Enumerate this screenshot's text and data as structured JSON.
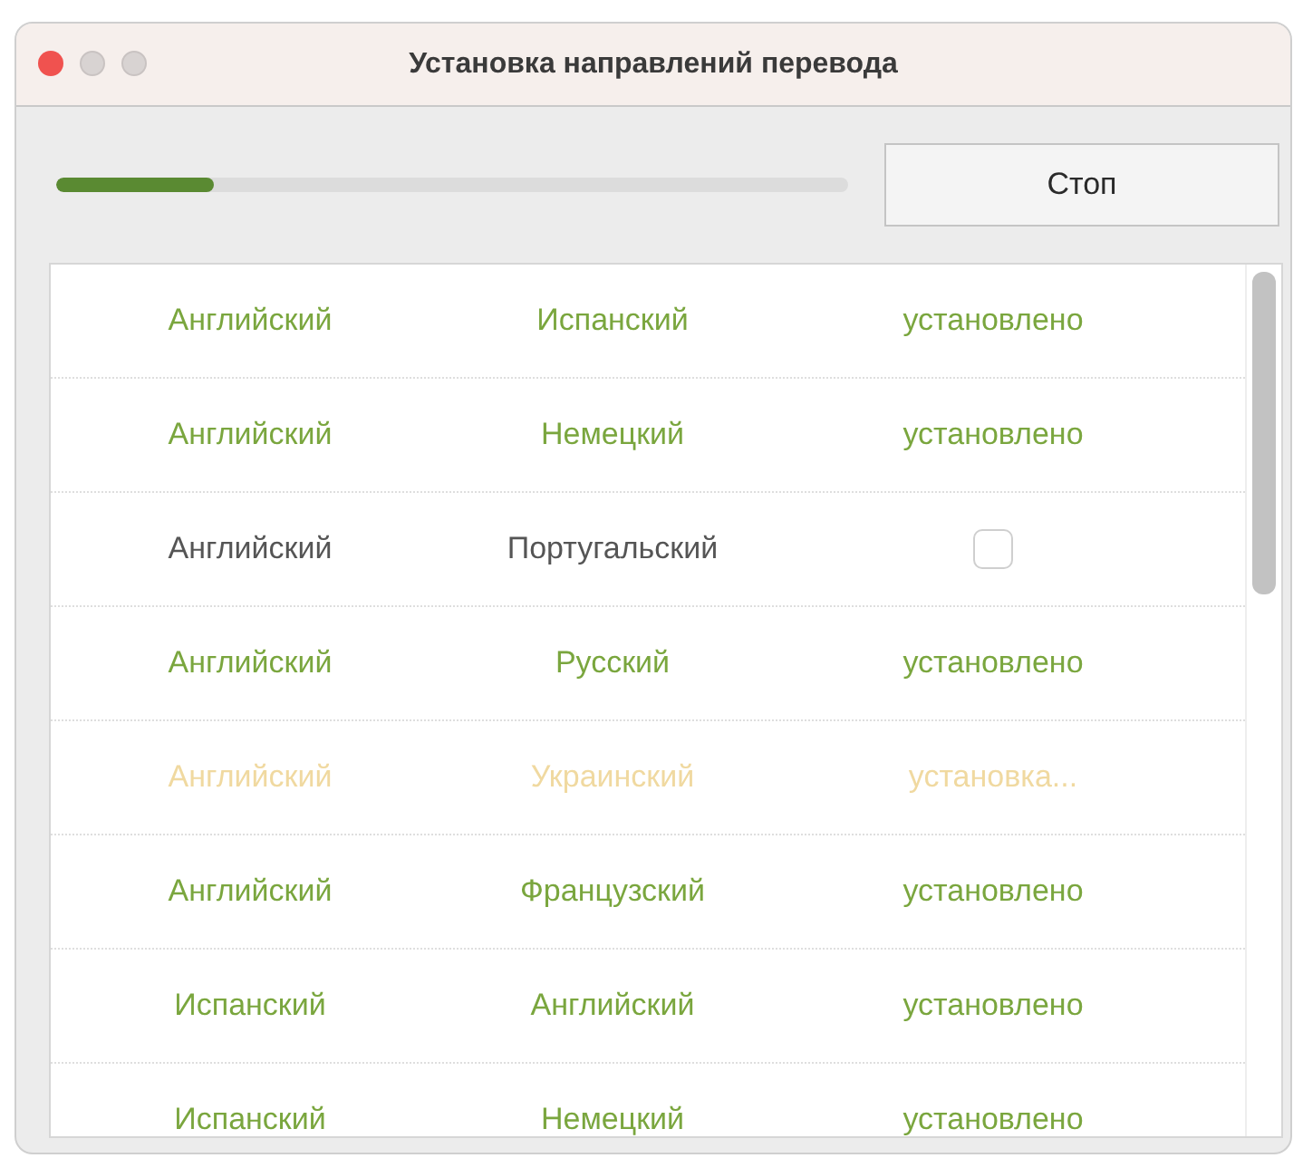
{
  "window": {
    "title": "Установка направлений перевода"
  },
  "progress": {
    "level": 0.2
  },
  "stop_button": {
    "label": "Стоп"
  },
  "rows": [
    {
      "kind": "installed",
      "source": "Английский",
      "target": "Испанский",
      "status": "установлено"
    },
    {
      "kind": "installed",
      "source": "Английский",
      "target": "Немецкий",
      "status": "установлено"
    },
    {
      "kind": "available",
      "source": "Английский",
      "target": "Португальский",
      "checked": false
    },
    {
      "kind": "installed",
      "source": "Английский",
      "target": "Русский",
      "status": "установлено"
    },
    {
      "kind": "installing",
      "source": "Английский",
      "target": "Украинский",
      "status": "установка..."
    },
    {
      "kind": "installed",
      "source": "Английский",
      "target": "Французский",
      "status": "установлено"
    },
    {
      "kind": "installed",
      "source": "Испанский",
      "target": "Английский",
      "status": "установлено"
    },
    {
      "kind": "installed",
      "source": "Испанский",
      "target": "Немецкий",
      "status": "установлено"
    }
  ]
}
